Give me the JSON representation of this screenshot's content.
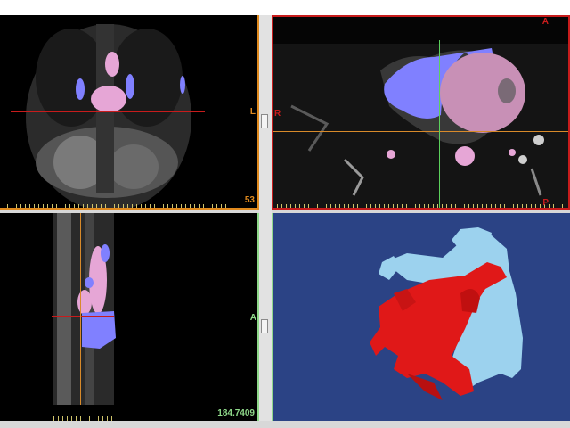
{
  "colors": {
    "coronal_frame": "#e08a1e",
    "axial_frame": "#c81c1c",
    "sagittal_frame": "#8fd98a",
    "render_background": "#2b4385",
    "crosshair_red": "#c81c1c",
    "crosshair_green": "#5cd15c",
    "crosshair_orange": "#d88a2a",
    "segment_blue": "#8080ff",
    "segment_pink": "#e6a6d6",
    "mesh_red": "#e01818",
    "mesh_lightblue": "#9cd2ee"
  },
  "icons": [
    "slider-handle-icon"
  ],
  "views": {
    "coronal": {
      "slice_number": "53",
      "orientation_marker": "L"
    },
    "axial": {
      "top_marker": "A",
      "left_marker": "R",
      "bottom_marker": "P"
    },
    "sagittal": {
      "slice_position": "184.7409",
      "orientation_marker": "A"
    },
    "render3d": {}
  }
}
